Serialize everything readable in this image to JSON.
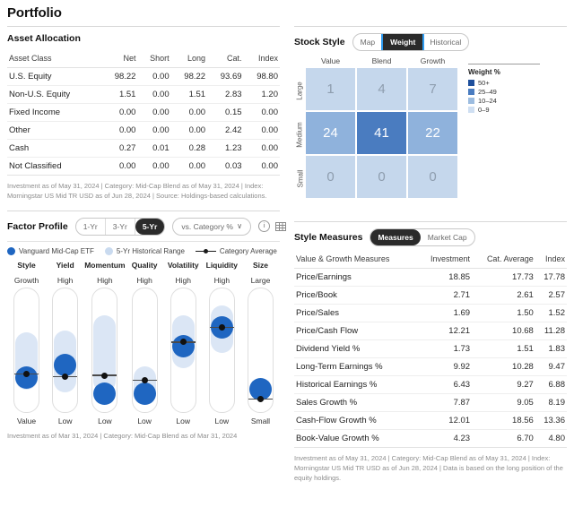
{
  "page": {
    "title": "Portfolio"
  },
  "asset_allocation": {
    "title": "Asset Allocation",
    "columns": [
      "Asset Class",
      "Net",
      "Short",
      "Long",
      "Cat.",
      "Index"
    ],
    "rows": [
      {
        "label": "U.S. Equity",
        "net": "98.22",
        "short": "0.00",
        "long": "98.22",
        "cat": "93.69",
        "index": "98.80"
      },
      {
        "label": "Non-U.S. Equity",
        "net": "1.51",
        "short": "0.00",
        "long": "1.51",
        "cat": "2.83",
        "index": "1.20"
      },
      {
        "label": "Fixed Income",
        "net": "0.00",
        "short": "0.00",
        "long": "0.00",
        "cat": "0.15",
        "index": "0.00"
      },
      {
        "label": "Other",
        "net": "0.00",
        "short": "0.00",
        "long": "0.00",
        "cat": "2.42",
        "index": "0.00"
      },
      {
        "label": "Cash",
        "net": "0.27",
        "short": "0.01",
        "long": "0.28",
        "cat": "1.23",
        "index": "0.00"
      },
      {
        "label": "Not Classified",
        "net": "0.00",
        "short": "0.00",
        "long": "0.00",
        "cat": "0.03",
        "index": "0.00"
      }
    ],
    "footnote": "Investment as of May 31, 2024 | Category: Mid-Cap Blend as of May 31, 2024 | Index: Morningstar US Mid TR USD as of Jun 28, 2024 | Source: Holdings-based calculations."
  },
  "stock_style": {
    "title": "Stock Style",
    "tabs": [
      {
        "label": "Map",
        "active": false
      },
      {
        "label": "Weight",
        "active": true
      },
      {
        "label": "Historical",
        "active": false
      }
    ],
    "col_headers": [
      "Value",
      "Blend",
      "Growth"
    ],
    "row_headers": [
      "Large",
      "Medium",
      "Small"
    ],
    "cells": [
      [
        {
          "value": "1",
          "tier": "0-9"
        },
        {
          "value": "4",
          "tier": "0-9"
        },
        {
          "value": "7",
          "tier": "0-9"
        }
      ],
      [
        {
          "value": "24",
          "tier": "10-24"
        },
        {
          "value": "41",
          "tier": "25-49"
        },
        {
          "value": "22",
          "tier": "10-24"
        }
      ],
      [
        {
          "value": "0",
          "tier": "0-9"
        },
        {
          "value": "0",
          "tier": "0-9"
        },
        {
          "value": "0",
          "tier": "0-9"
        }
      ]
    ],
    "legend": {
      "title": "Weight %",
      "items": [
        {
          "label": "50+",
          "color": "#1e4f9c"
        },
        {
          "label": "25–49",
          "color": "#4a7cc0"
        },
        {
          "label": "10–24",
          "color": "#9cbce0"
        },
        {
          "label": "0–9",
          "color": "#cfdff2"
        }
      ]
    },
    "tier_colors": {
      "50+": "#1e4f9c",
      "25-49": "#4a7cc0",
      "10-24": "#8fb2dc",
      "0-9": "#c5d7ec"
    },
    "tier_text_colors": {
      "50+": "#ffffff",
      "25-49": "#ffffff",
      "10-24": "#ffffff",
      "0-9": "#8e9dae"
    }
  },
  "factor_profile": {
    "title": "Factor Profile",
    "period_tabs": [
      {
        "label": "1-Yr",
        "active": false
      },
      {
        "label": "3-Yr",
        "active": false
      },
      {
        "label": "5-Yr",
        "active": true
      }
    ],
    "comparison": {
      "label": "vs. Category %",
      "caret": "∨"
    },
    "icons": {
      "info": "info-icon",
      "table": "table-icon"
    },
    "legend": [
      {
        "label": "Vanguard Mid-Cap ETF",
        "marker": "solid-dot",
        "color": "#1f66c1"
      },
      {
        "label": "5-Yr Historical Range",
        "marker": "pale-dot",
        "color": "#c9daef"
      },
      {
        "label": "Category Average",
        "marker": "line-dot",
        "color": "#1a1a1a"
      }
    ],
    "factors": [
      {
        "name": "Style",
        "top": "Growth",
        "bottom": "Value",
        "range_top": 36,
        "range_height": 46,
        "bubble": 72,
        "cat": 69
      },
      {
        "name": "Yield",
        "top": "High",
        "bottom": "Low",
        "range_top": 34,
        "range_height": 50,
        "bubble": 62,
        "cat": 71
      },
      {
        "name": "Momentum",
        "top": "High",
        "bottom": "Low",
        "range_top": 22,
        "range_height": 62,
        "bubble": 85,
        "cat": 70
      },
      {
        "name": "Quality",
        "top": "High",
        "bottom": "Low",
        "range_top": 63,
        "range_height": 28,
        "bubble": 85,
        "cat": 74
      },
      {
        "name": "Volatility",
        "top": "High",
        "bottom": "Low",
        "range_top": 22,
        "range_height": 43,
        "bubble": 47,
        "cat": 43
      },
      {
        "name": "Liquidity",
        "top": "High",
        "bottom": "Low",
        "range_top": 14,
        "range_height": 38,
        "bubble": 32,
        "cat": 31
      },
      {
        "name": "Size",
        "top": "Large",
        "bottom": "Small",
        "range_top": 74,
        "range_height": 16,
        "bubble": 82,
        "cat": 89
      }
    ],
    "footnote": "Investment as of Mar 31, 2024 | Category: Mid-Cap Blend as of Mar 31, 2024"
  },
  "style_measures": {
    "title": "Style Measures",
    "tabs": [
      {
        "label": "Measures",
        "active": true
      },
      {
        "label": "Market Cap",
        "active": false
      }
    ],
    "columns": [
      "Value & Growth Measures",
      "Investment",
      "Cat. Average",
      "Index"
    ],
    "rows": [
      {
        "label": "Price/Earnings",
        "investment": "18.85",
        "cat_average": "17.73",
        "index": "17.78"
      },
      {
        "label": "Price/Book",
        "investment": "2.71",
        "cat_average": "2.61",
        "index": "2.57"
      },
      {
        "label": "Price/Sales",
        "investment": "1.69",
        "cat_average": "1.50",
        "index": "1.52"
      },
      {
        "label": "Price/Cash Flow",
        "investment": "12.21",
        "cat_average": "10.68",
        "index": "11.28"
      },
      {
        "label": "Dividend Yield %",
        "investment": "1.73",
        "cat_average": "1.51",
        "index": "1.83"
      },
      {
        "label": "Long-Term Earnings %",
        "investment": "9.92",
        "cat_average": "10.28",
        "index": "9.47"
      },
      {
        "label": "Historical Earnings %",
        "investment": "6.43",
        "cat_average": "9.27",
        "index": "6.88"
      },
      {
        "label": "Sales Growth %",
        "investment": "7.87",
        "cat_average": "9.05",
        "index": "8.19"
      },
      {
        "label": "Cash-Flow Growth %",
        "investment": "12.01",
        "cat_average": "18.56",
        "index": "13.36"
      },
      {
        "label": "Book-Value Growth %",
        "investment": "4.23",
        "cat_average": "6.70",
        "index": "4.80"
      }
    ],
    "footnote": "Investment as of May 31, 2024 | Category: Mid-Cap Blend as of May 31, 2024 | Index: Morningstar US Mid TR USD as of Jun 28, 2024 | Data is based on the long position of the equity holdings."
  }
}
